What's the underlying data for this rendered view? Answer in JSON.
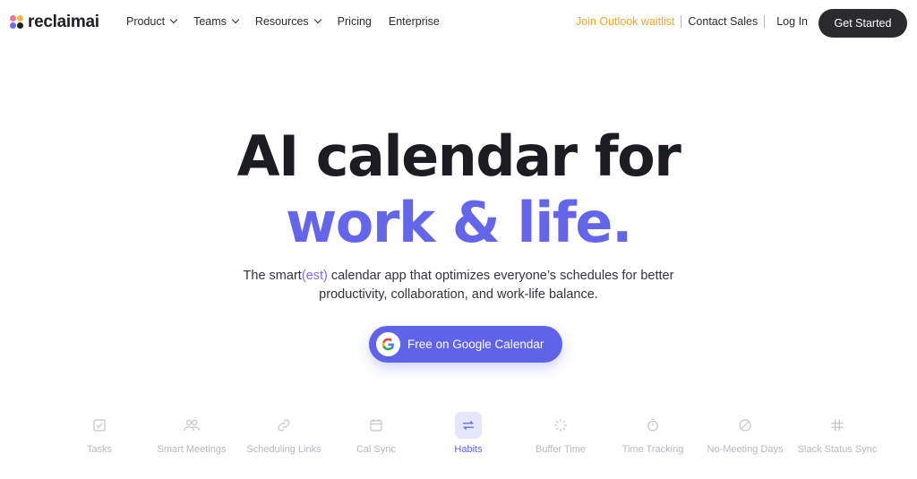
{
  "brand": {
    "name": "reclaimai"
  },
  "nav": {
    "items": [
      {
        "label": "Product",
        "has_dropdown": true
      },
      {
        "label": "Teams",
        "has_dropdown": true
      },
      {
        "label": "Resources",
        "has_dropdown": true
      },
      {
        "label": "Pricing",
        "has_dropdown": false
      },
      {
        "label": "Enterprise",
        "has_dropdown": false
      }
    ],
    "waitlist": "Join Outlook waitlist",
    "contact": "Contact Sales",
    "login": "Log In",
    "get_started": "Get Started"
  },
  "hero": {
    "title_line1": "AI calendar for",
    "title_line2": "work & life.",
    "subtitle_prefix": "The smart",
    "subtitle_accent": "(est)",
    "subtitle_rest": " calendar app that optimizes everyone’s schedules for better",
    "subtitle_line2": "productivity, collaboration, and work-life balance.",
    "cta_label": "Free on Google Calendar"
  },
  "features": [
    {
      "label": "Tasks",
      "icon": "checkbox-icon",
      "active": false
    },
    {
      "label": "Smart Meetings",
      "icon": "people-icon",
      "active": false
    },
    {
      "label": "Scheduling Links",
      "icon": "link-icon",
      "active": false
    },
    {
      "label": "Cal Sync",
      "icon": "calendar-icon",
      "active": false
    },
    {
      "label": "Habits",
      "icon": "repeat-icon",
      "active": true
    },
    {
      "label": "Buffer Time",
      "icon": "loader-icon",
      "active": false
    },
    {
      "label": "Time Tracking",
      "icon": "stopwatch-icon",
      "active": false
    },
    {
      "label": "No-Meeting Days",
      "icon": "prohibit-icon",
      "active": false
    },
    {
      "label": "Slack Status Sync",
      "icon": "slack-icon",
      "active": false
    }
  ],
  "colors": {
    "accent": "#6366ea",
    "cta_bg": "#5f63ea",
    "waitlist": "#f0a824",
    "dark_button": "#2b2b2e",
    "feature_inactive": "#b7b8bd"
  }
}
